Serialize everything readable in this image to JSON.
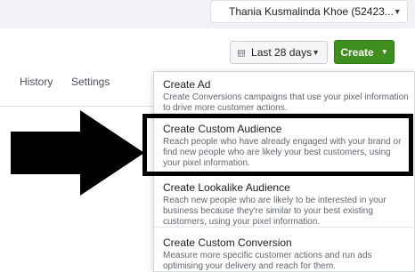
{
  "account": {
    "name": "Thania Kusmalinda Khoe (52423..."
  },
  "tabs": [
    {
      "label": "History"
    },
    {
      "label": "Settings"
    }
  ],
  "date_filter": {
    "label": "Last 28 days"
  },
  "create_button": {
    "label": "Create"
  },
  "menu": {
    "items": [
      {
        "title": "Create Ad",
        "description": "Create Conversions campaigns that use your pixel information to drive more customer actions."
      },
      {
        "title": "Create Custom Audience",
        "description": "Reach people who have already engaged with your brand or find new people who are likely your best customers, using your pixel information."
      },
      {
        "title": "Create Lookalike Audience",
        "description": "Reach new people who are likely to be interested in your business because they're similar to your best existing customers, using your pixel information."
      },
      {
        "title": "Create Custom Conversion",
        "description": "Measure more specific customer actions and run ads optimising your delivery and reach for them."
      }
    ]
  },
  "colors": {
    "create_green": "#3f8f1f",
    "highlight_border": "#000000",
    "top_bar": "#f0f2f5"
  },
  "icons": {
    "account": "briefcase-icon",
    "date": "calendar-icon",
    "dropdown": "caret-down-icon",
    "annotation": "arrow-right-icon"
  }
}
